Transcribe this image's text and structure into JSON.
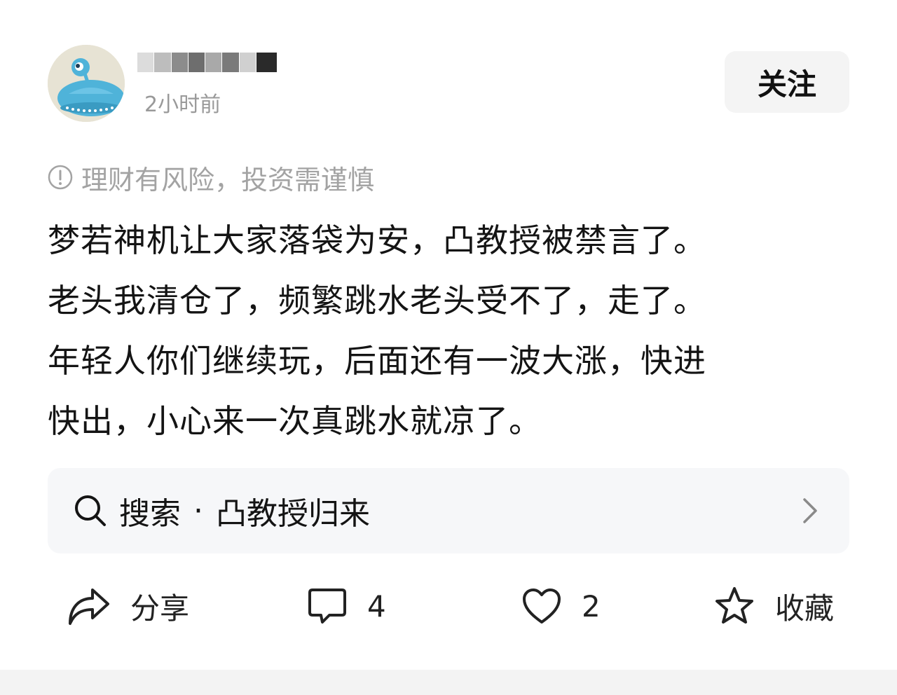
{
  "header": {
    "timestamp": "2小时前",
    "follow_label": "关注"
  },
  "risk_notice": {
    "icon": "exclamation-circle-icon",
    "text": "理财有风险，投资需谨慎"
  },
  "post": {
    "lines": [
      "梦若神机让大家落袋为安，凸教授被禁言了。",
      "老头我清仓了，频繁跳水老头受不了，走了。",
      "年轻人你们继续玩，后面还有一波大涨，快进",
      "快出，小心来一次真跳水就凉了。"
    ]
  },
  "search": {
    "icon": "search-icon",
    "label": "搜索",
    "separator": "·",
    "query": "凸教授归来",
    "chevron": "chevron-right-icon"
  },
  "actions": {
    "share": {
      "icon": "share-icon",
      "label": "分享"
    },
    "comment": {
      "icon": "comment-icon",
      "count": "4"
    },
    "like": {
      "icon": "heart-icon",
      "count": "2"
    },
    "favorite": {
      "icon": "star-icon",
      "label": "收藏"
    }
  },
  "colors": {
    "avatar_bg": "#e7e3d4",
    "avatar_figure": "#4fb3d9",
    "muted_text": "#999999",
    "card_bg": "#f6f7f9"
  }
}
